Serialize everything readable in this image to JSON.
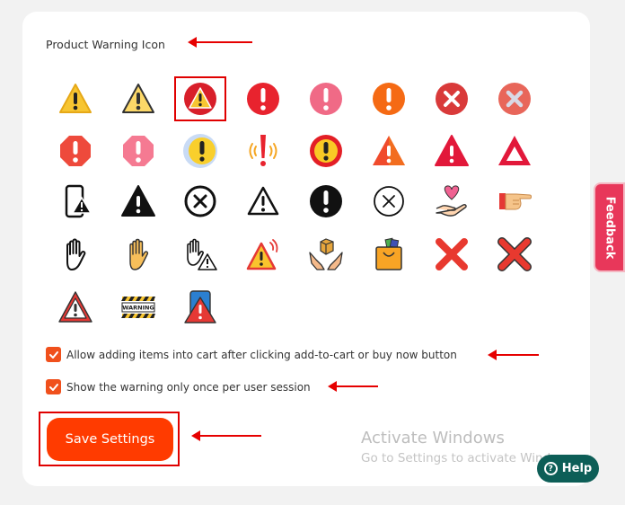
{
  "section": {
    "title": "Product Warning Icon"
  },
  "icons": [
    "warning-triangle-yellow-icon",
    "warning-triangle-outline-icon",
    "warning-triangle-red-circle-icon",
    "exclamation-red-circle-icon",
    "exclamation-pink-circle-icon",
    "exclamation-orange-circle-icon",
    "x-red-circle-icon",
    "x-salmon-circle-icon",
    "exclamation-red-octagon-icon",
    "exclamation-pink-octagon-icon",
    "exclamation-yellow-blob-icon",
    "exclamation-alarm-icon",
    "exclamation-red-ring-icon",
    "warning-triangle-orange-icon",
    "warning-triangle-crimson-icon",
    "warning-triangle-hollow-red-icon",
    "phone-warning-icon",
    "warning-triangle-black-icon",
    "x-outline-circle-icon",
    "warning-triangle-line-icon",
    "exclamation-black-circle-icon",
    "x-thin-circle-icon",
    "heart-hand-icon",
    "pointing-hand-icon",
    "stop-hand-outline-icon",
    "stop-hand-yellow-icon",
    "hand-warning-icon",
    "warning-signal-icon",
    "package-hands-icon",
    "shopping-bag-icon",
    "x-red-icon",
    "x-red-outline-icon",
    "warning-triangle-red-outline-icon",
    "warning-tape-icon",
    "phone-warning-red-icon"
  ],
  "warning_tape_text": "WARNING",
  "selected_icon_index": 2,
  "options": {
    "allow_cart": {
      "label": "Allow adding items into cart after clicking add-to-cart or buy now button",
      "checked": true
    },
    "once_per_session": {
      "label": "Show the warning only once per user session",
      "checked": true
    }
  },
  "save_label": "Save Settings",
  "watermark": {
    "line1": "Activate Windows",
    "line2": "Go to Settings to activate Windows."
  },
  "help_label": "Help",
  "help_icon": "?",
  "feedback_label": "Feedback",
  "colors": {
    "accent": "#ff3b00",
    "checkbox": "#f0501c",
    "help": "#0d5e57",
    "feedback": "#e8375a",
    "annotation": "#e60000"
  }
}
